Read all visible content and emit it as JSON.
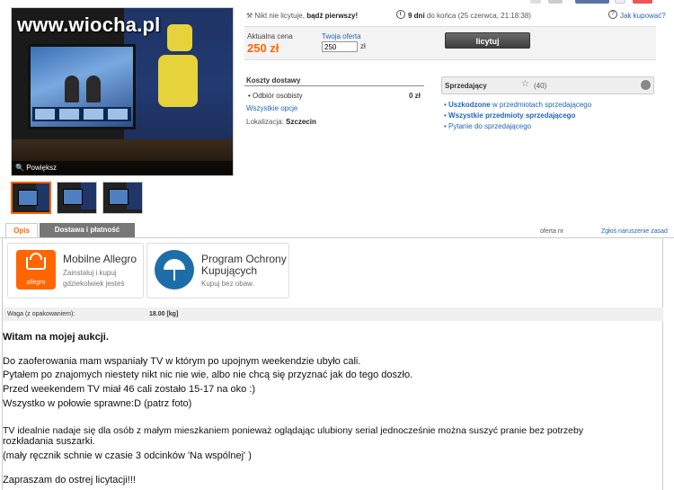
{
  "watermark": "www.wiocha.pl",
  "photo": {
    "enlarge_label": "Powiększ"
  },
  "info": {
    "bids_text_prefix": "Nikt nie licytuje,",
    "bids_text_bold": "bądź pierwszy!",
    "time_bold": "9 dni",
    "time_rest": "do końca (25 czerwca, 21:18:38)",
    "help_label": "Jak kupować?"
  },
  "bid": {
    "current_price_label": "Aktualna cena",
    "current_price": "250 zł",
    "your_offer_label": "Twoja oferta",
    "your_offer_value": "250",
    "currency": "zł",
    "bid_button": "licytuj"
  },
  "shipping": {
    "title": "Koszty dostawy",
    "item_label": "Odbiór osobisty",
    "item_price": "0 zł",
    "all_options": "Wszystkie opcje",
    "location_label": "Lokalizacja:",
    "location_value": "Szczecin"
  },
  "seller": {
    "label": "Sprzedający",
    "score": "(40)",
    "links": [
      {
        "prefix": "Uszkodzone",
        "rest": " w przedmiotach sprzedającego"
      },
      {
        "prefix": "Wszystkie przedmioty sprzedającego",
        "rest": ""
      },
      {
        "prefix": "",
        "rest": "Pytanie do sprzedającego"
      }
    ]
  },
  "tabs": {
    "opis": "Opis",
    "dostawa": "Dostawa i płatność",
    "offer_no": "oferta nr",
    "report": "Zgłoś naruszenie zasad"
  },
  "promo": {
    "mobile_title": "Mobilne Allegro",
    "mobile_sub1": "Zainstaluj i kupuj",
    "mobile_sub2": "gdziekolwiek jesteś",
    "mobile_icon_word": "allegro",
    "protect_title1": "Program Ochrony",
    "protect_title2": "Kupujących",
    "protect_sub": "Kupuj bez obaw."
  },
  "weight": {
    "label": "Waga (z opakowaniem):",
    "value": "18.00 [kg]"
  },
  "description": {
    "heading": "Witam na mojej aukcji.",
    "lines": [
      "Do zaoferowania mam wspaniały TV w którym po upojnym weekendzie ubyło cali.",
      "Pytałem po znajomych niestety nikt nic nie wie, albo nie chcą się przyznać jak do tego doszło.",
      "Przed weekendem TV miał 46 cali zostało 15-17 na oko :)",
      "Wszystko w połowie sprawne:D (patrz foto)",
      "TV idealnie nadaje się dla osób z małym mieszkaniem ponieważ oglądając ulubiony serial jednocześnie można suszyć pranie bez potrzeby",
      "rozkładania suszarki.",
      "(mały ręcznik schnie w czasie 3 odcinków 'Na wspólnej' )",
      "Zapraszam do ostrej licytacji!!!"
    ]
  }
}
